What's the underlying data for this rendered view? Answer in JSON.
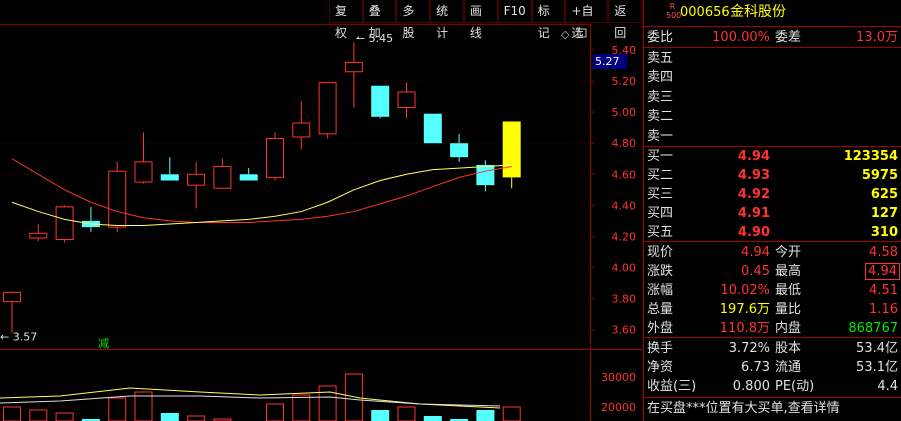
{
  "toolbar": {
    "buttons": [
      "复权",
      "叠加",
      "多股",
      "统计",
      "画线",
      "F10",
      "标记",
      "+自选",
      "返回"
    ]
  },
  "stock": {
    "badge_top": "R",
    "badge_bottom": "500",
    "code": "000656",
    "name": "金科股份"
  },
  "chart_data": {
    "type": "candlestick",
    "yticks": [
      "5.40",
      "5.20",
      "5.00",
      "4.80",
      "4.60",
      "4.40",
      "4.20",
      "4.00",
      "3.80",
      "3.60"
    ],
    "ylim": [
      3.55,
      5.55
    ],
    "current_price_tag": "5.27",
    "annotations": {
      "high": "5.45",
      "low": "3.57",
      "marker": "减"
    },
    "candles": [
      {
        "o": 3.78,
        "h": 3.84,
        "l": 3.58,
        "c": 3.84,
        "up": true
      },
      {
        "o": 4.19,
        "h": 4.28,
        "l": 4.17,
        "c": 4.22,
        "up": true
      },
      {
        "o": 4.18,
        "h": 4.4,
        "l": 4.16,
        "c": 4.39,
        "up": true
      },
      {
        "o": 4.26,
        "h": 4.39,
        "l": 4.23,
        "c": 4.3,
        "up": false
      },
      {
        "o": 4.26,
        "h": 4.68,
        "l": 4.23,
        "c": 4.62,
        "up": true
      },
      {
        "o": 4.55,
        "h": 4.87,
        "l": 4.54,
        "c": 4.68,
        "up": true
      },
      {
        "o": 4.6,
        "h": 4.71,
        "l": 4.56,
        "c": 4.56,
        "up": false
      },
      {
        "o": 4.53,
        "h": 4.68,
        "l": 4.38,
        "c": 4.6,
        "up": true
      },
      {
        "o": 4.51,
        "h": 4.7,
        "l": 4.51,
        "c": 4.65,
        "up": true
      },
      {
        "o": 4.6,
        "h": 4.64,
        "l": 4.56,
        "c": 4.56,
        "up": false
      },
      {
        "o": 4.58,
        "h": 4.87,
        "l": 4.56,
        "c": 4.83,
        "up": true
      },
      {
        "o": 4.84,
        "h": 5.07,
        "l": 4.76,
        "c": 4.93,
        "up": true
      },
      {
        "o": 4.86,
        "h": 5.19,
        "l": 4.83,
        "c": 5.19,
        "up": true
      },
      {
        "o": 5.32,
        "h": 5.45,
        "l": 5.03,
        "c": 5.26,
        "up": true
      },
      {
        "o": 5.17,
        "h": 5.17,
        "l": 4.96,
        "c": 4.97,
        "up": false
      },
      {
        "o": 5.13,
        "h": 5.19,
        "l": 4.96,
        "c": 5.03,
        "up": true
      },
      {
        "o": 4.99,
        "h": 4.99,
        "l": 4.8,
        "c": 4.8,
        "up": false
      },
      {
        "o": 4.8,
        "h": 4.86,
        "l": 4.68,
        "c": 4.71,
        "up": false
      },
      {
        "o": 4.66,
        "h": 4.69,
        "l": 4.49,
        "c": 4.53,
        "up": false
      },
      {
        "o": 4.58,
        "h": 4.94,
        "l": 4.51,
        "c": 4.94,
        "up": true,
        "limit": true
      }
    ],
    "ma_yellow": [
      4.42,
      4.36,
      4.31,
      4.28,
      4.27,
      4.27,
      4.28,
      4.29,
      4.3,
      4.31,
      4.33,
      4.36,
      4.42,
      4.5,
      4.56,
      4.6,
      4.63,
      4.64,
      4.65,
      4.66
    ],
    "ma_red": [
      4.7,
      4.6,
      4.5,
      4.42,
      4.36,
      4.32,
      4.3,
      4.29,
      4.29,
      4.29,
      4.3,
      4.31,
      4.33,
      4.36,
      4.41,
      4.46,
      4.52,
      4.58,
      4.62,
      4.65
    ],
    "volume": {
      "yticks": [
        "30000",
        "20000"
      ],
      "ylim": [
        14000,
        33000
      ],
      "bars": [
        {
          "v": 20000,
          "up": true
        },
        {
          "v": 19000,
          "up": true
        },
        {
          "v": 18000,
          "up": true
        },
        {
          "v": 16000,
          "up": false
        },
        {
          "v": 23000,
          "up": true
        },
        {
          "v": 25000,
          "up": true
        },
        {
          "v": 18000,
          "up": false
        },
        {
          "v": 17000,
          "up": true
        },
        {
          "v": 16000,
          "up": true
        },
        {
          "v": 15000,
          "up": false
        },
        {
          "v": 21000,
          "up": true
        },
        {
          "v": 24000,
          "up": true
        },
        {
          "v": 27000,
          "up": true
        },
        {
          "v": 31000,
          "up": true
        },
        {
          "v": 19000,
          "up": false
        },
        {
          "v": 20000,
          "up": true
        },
        {
          "v": 17000,
          "up": false
        },
        {
          "v": 16000,
          "up": false
        },
        {
          "v": 19000,
          "up": false
        },
        {
          "v": 20000,
          "up": true
        }
      ]
    }
  },
  "quote": {
    "wei_bi_label": "委比",
    "wei_bi": "100.00%",
    "wei_cha_label": "委差",
    "wei_cha": "13.0万",
    "sell": [
      {
        "label": "卖五"
      },
      {
        "label": "卖四"
      },
      {
        "label": "卖三"
      },
      {
        "label": "卖二"
      },
      {
        "label": "卖一"
      }
    ],
    "buy": [
      {
        "label": "买一",
        "price": "4.94",
        "vol": "123354"
      },
      {
        "label": "买二",
        "price": "4.93",
        "vol": "5975"
      },
      {
        "label": "买三",
        "price": "4.92",
        "vol": "625"
      },
      {
        "label": "买四",
        "price": "4.91",
        "vol": "127"
      },
      {
        "label": "买五",
        "price": "4.90",
        "vol": "310"
      }
    ],
    "stats": [
      {
        "l1": "现价",
        "v1": "4.94",
        "c1": "red",
        "l2": "今开",
        "v2": "4.58",
        "c2": "red"
      },
      {
        "l1": "涨跌",
        "v1": "0.45",
        "c1": "red",
        "l2": "最高",
        "v2": "4.94",
        "c2": "red",
        "box2": true
      },
      {
        "l1": "涨幅",
        "v1": "10.02%",
        "c1": "red",
        "l2": "最低",
        "v2": "4.51",
        "c2": "red"
      },
      {
        "l1": "总量",
        "v1": "197.6万",
        "c1": "yel",
        "l2": "量比",
        "v2": "1.16",
        "c2": "red"
      },
      {
        "l1": "外盘",
        "v1": "110.8万",
        "c1": "red",
        "l2": "内盘",
        "v2": "868767",
        "c2": "grn"
      }
    ],
    "fund": [
      {
        "l1": "换手",
        "v1": "3.72%",
        "l2": "股本",
        "v2": "53.4亿"
      },
      {
        "l1": "净资",
        "v1": "6.73",
        "l2": "流通",
        "v2": "53.1亿"
      },
      {
        "l1": "收益(三)",
        "v1": "0.800",
        "l2": "PE(动)",
        "v2": "4.4"
      }
    ],
    "footer": "在买盘***位置有大买单,查看详情"
  },
  "colors": {
    "up": "#ff3232",
    "down": "#54ffff",
    "limit": "#ffff00",
    "ma_yellow": "#ffff66",
    "ma_red": "#ff3232"
  }
}
